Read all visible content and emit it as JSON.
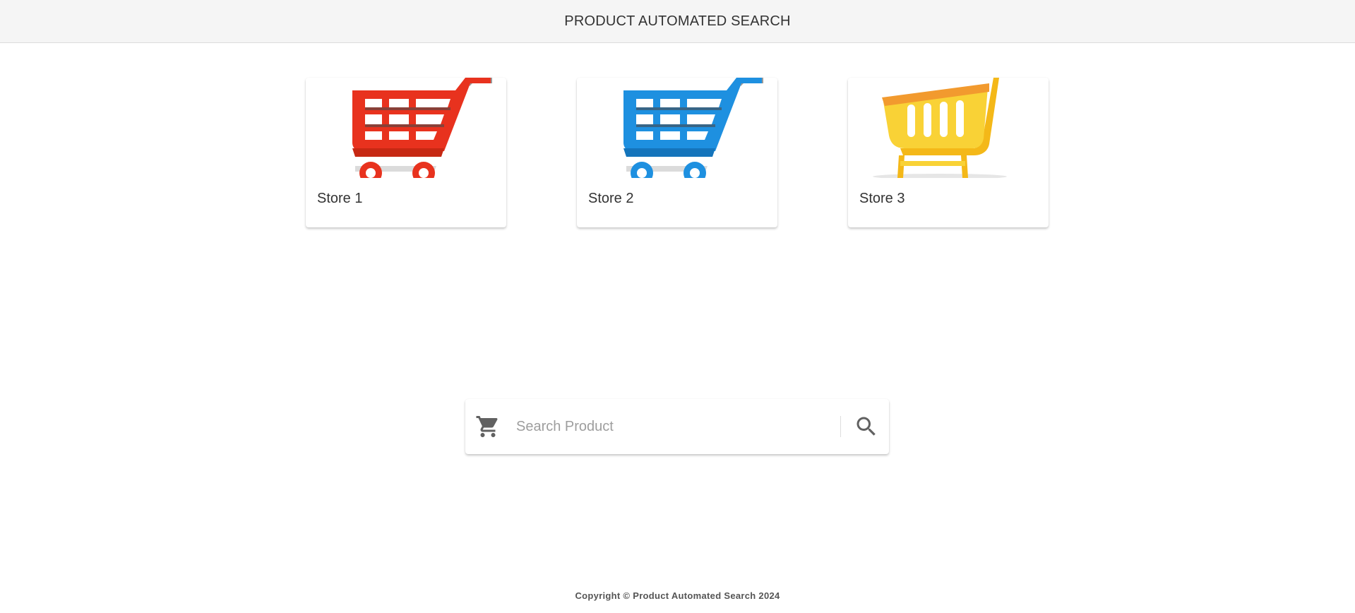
{
  "header": {
    "title": "PRODUCT AUTOMATED SEARCH"
  },
  "stores": [
    {
      "label": "Store 1",
      "icon": "red-shopping-cart-icon",
      "color": "#e8321e"
    },
    {
      "label": "Store 2",
      "icon": "blue-shopping-cart-icon",
      "color": "#1e90e0"
    },
    {
      "label": "Store 3",
      "icon": "yellow-shopping-cart-icon",
      "color": "#f6c21c"
    }
  ],
  "search": {
    "placeholder": "Search Product",
    "value": "",
    "leading_icon": "shopping-cart-icon",
    "button_icon": "search-icon"
  },
  "footer": {
    "copyright": "Copyright © Product Automated Search 2024"
  }
}
